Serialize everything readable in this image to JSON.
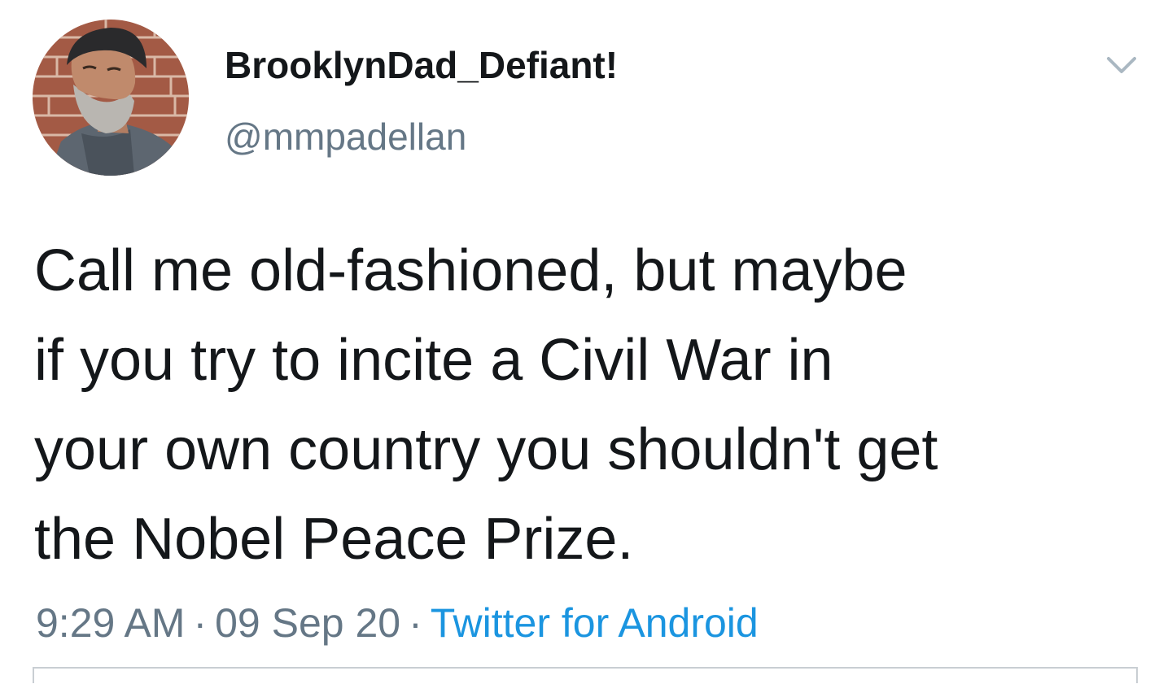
{
  "tweet": {
    "author": {
      "display_name": "BrooklynDad_Defiant!",
      "handle": "@mmpadellan",
      "avatar_icon": "user-avatar-photo"
    },
    "menu_icon": "chevron-down-icon",
    "text_lines": [
      "Call me old-fashioned, but maybe",
      "if you try to incite a Civil War in",
      "your own country you shouldn't get",
      "the Nobel Peace Prize."
    ],
    "meta": {
      "time": "9:29 AM",
      "separator": "·",
      "date": "09 Sep 20",
      "source": "Twitter for Android"
    }
  },
  "colors": {
    "text_primary": "#14171a",
    "text_secondary": "#657786",
    "link": "#1b95e0",
    "chevron": "#aab8c2",
    "divider": "#c9ced3"
  }
}
